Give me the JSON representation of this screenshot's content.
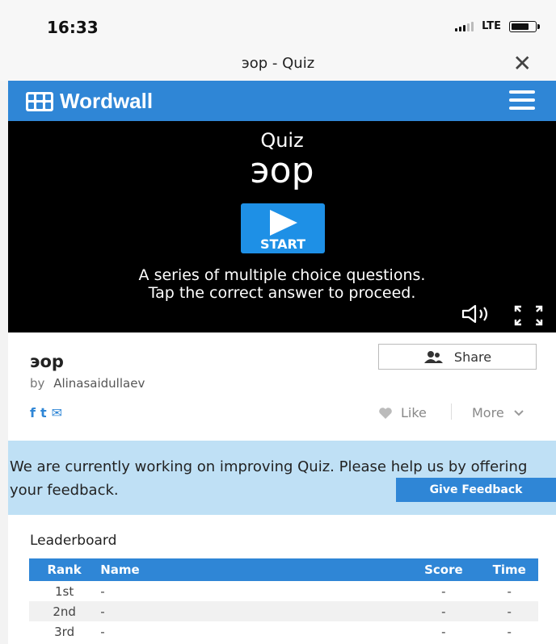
{
  "status_bar": {
    "time": "16:33",
    "network": "LTE"
  },
  "nav_bar": {
    "title": "эор - Quiz",
    "close_glyph": "✕"
  },
  "wordwall": {
    "brand": "Wordwall"
  },
  "game": {
    "kind": "Quiz",
    "name": "эор",
    "start_label": "START",
    "description": "A series of multiple choice questions. Tap the correct answer to proceed."
  },
  "activity": {
    "title": "эор",
    "by_label": "by",
    "author": "Alinasaidullaev",
    "share_label": "Share",
    "like_label": "Like",
    "more_label": "More"
  },
  "social": {
    "facebook_glyph": "f",
    "twitter_glyph": "t",
    "email_glyph": "✉"
  },
  "feedback": {
    "message": "We are currently working on improving Quiz. Please help us by offering your feedback.",
    "button_label": "Give Feedback"
  },
  "leaderboard": {
    "title": "Leaderboard",
    "headers": {
      "rank": "Rank",
      "name": "Name",
      "score": "Score",
      "time": "Time"
    },
    "rows": [
      {
        "rank": "1st",
        "name": "-",
        "score": "-",
        "time": "-"
      },
      {
        "rank": "2nd",
        "name": "-",
        "score": "-",
        "time": "-"
      },
      {
        "rank": "3rd",
        "name": "-",
        "score": "-",
        "time": "-"
      }
    ]
  },
  "colors": {
    "brand_blue": "#2f86d6",
    "start_blue": "#1e90e6",
    "feedback_bg": "#bfe0f5",
    "stage_bg": "#000000"
  },
  "icons": {
    "signal": "signal-bars-icon",
    "battery": "battery-icon",
    "close": "close-icon",
    "logo": "wordwall-logo-icon",
    "menu": "hamburger-menu-icon",
    "play": "play-icon",
    "sound": "speaker-icon",
    "fullscreen": "fullscreen-icon",
    "share": "users-icon",
    "like": "heart-icon",
    "more": "chevron-down-icon"
  }
}
